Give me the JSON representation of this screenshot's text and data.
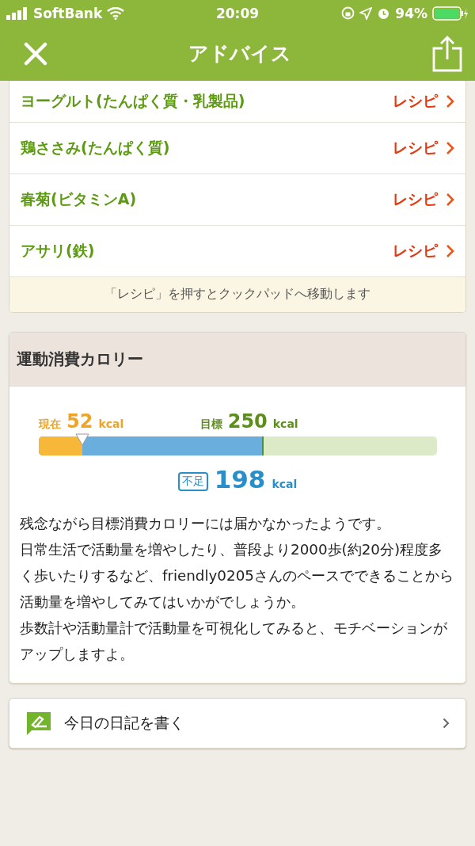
{
  "status_bar": {
    "carrier": "SoftBank",
    "time": "20:09",
    "battery": "94%"
  },
  "nav": {
    "title": "アドバイス"
  },
  "recipes": {
    "items": [
      {
        "name": "ヨーグルト(たんぱく質・乳製品)",
        "link": "レシピ"
      },
      {
        "name": "鶏ささみ(たんぱく質)",
        "link": "レシピ"
      },
      {
        "name": "春菊(ビタミンA)",
        "link": "レシピ"
      },
      {
        "name": "アサリ(鉄)",
        "link": "レシピ"
      }
    ],
    "note": "「レシピ」を押すとクックパッドへ移動します"
  },
  "exercise": {
    "title": "運動消費カロリー",
    "current": {
      "label": "現在",
      "value": "52",
      "unit": "kcal",
      "level": 0.11
    },
    "target": {
      "label": "目標",
      "value": "250",
      "unit": "kcal",
      "level": 0.56
    },
    "shortage": {
      "badge": "不足",
      "value": "198",
      "unit": "kcal"
    },
    "paragraphs": [
      "残念ながら目標消費カロリーには届かなかったようです。",
      "日常生活で活動量を増やしたり、普段より2000歩(約20分)程度多く歩いたりするなど、friendly0205さんのペースでできることから活動量を増やしてみてはいかがでしょうか。",
      "歩数計や活動量計で活動量を可視化してみると、モチベーションがアップしますよ。"
    ]
  },
  "diary_button": {
    "label": "今日の日記を書く"
  }
}
